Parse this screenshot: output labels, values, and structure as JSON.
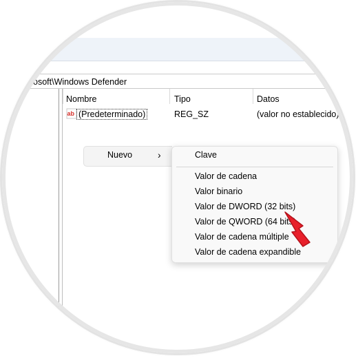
{
  "address": {
    "path": "osoft\\Windows Defender"
  },
  "columns": {
    "name": "Nombre",
    "type": "Tipo",
    "data": "Datos"
  },
  "rows": [
    {
      "name": "(Predeterminado)",
      "type": "REG_SZ",
      "data": "(valor no establecido)",
      "icon": "reg-string-icon"
    }
  ],
  "context_menu": {
    "nuevo_label": "Nuevo",
    "nuevo_arrow": "›"
  },
  "submenu": {
    "clave": "Clave",
    "items": [
      "Valor de cadena",
      "Valor binario",
      "Valor de DWORD (32 bits)",
      "Valor de QWORD (64 bits)",
      "Valor de cadena múltiple",
      "Valor de cadena expandible"
    ]
  },
  "colors": {
    "accent_arrow": "#e8202b",
    "toolbar_band": "#eef3f9"
  },
  "icon_text": {
    "reg_string": "ab"
  }
}
